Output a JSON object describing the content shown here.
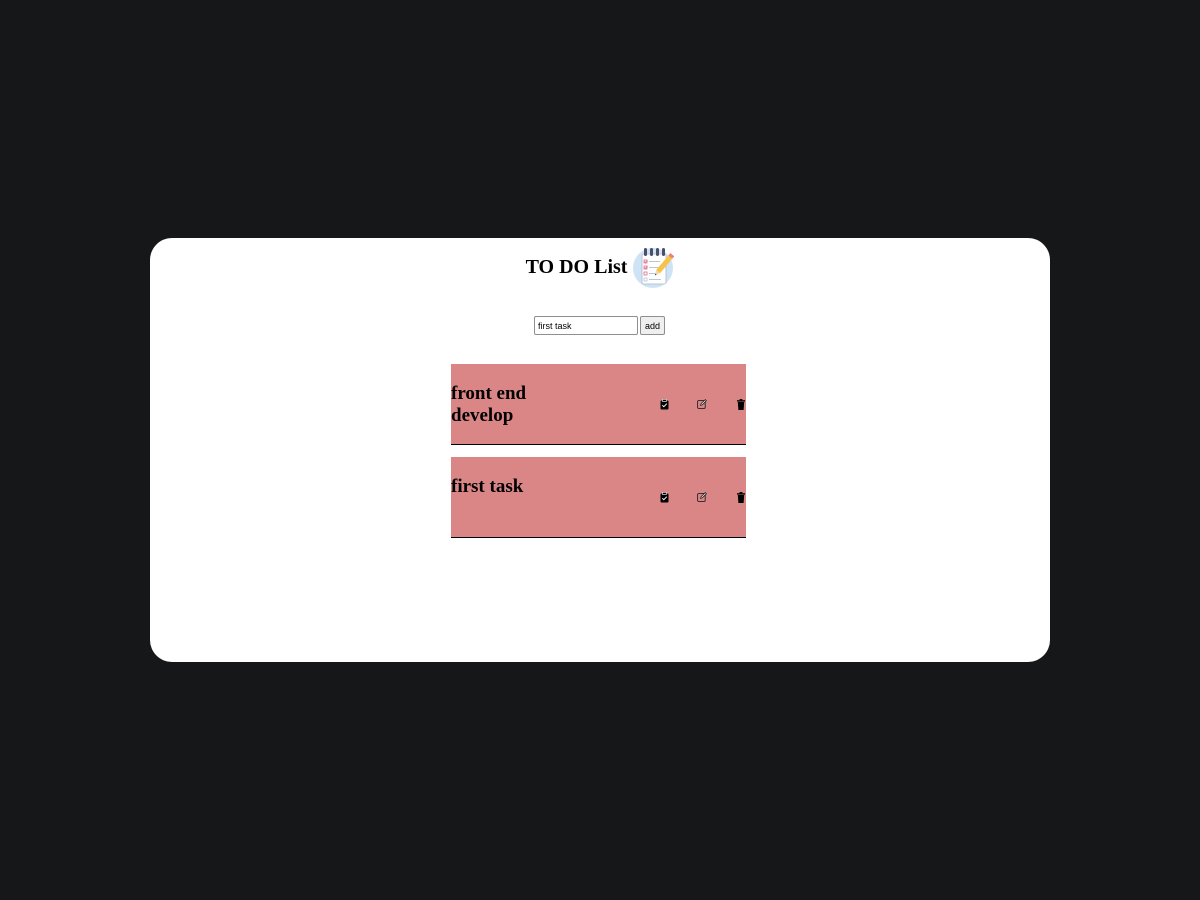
{
  "header": {
    "title": "TO DO List",
    "logo_icon": "notepad-checklist-icon"
  },
  "add_form": {
    "input_value": "first task",
    "button_label": "add"
  },
  "tasks": [
    {
      "text": "front end develop",
      "actions": [
        "clipboard-check-icon",
        "edit-icon",
        "trash-icon"
      ]
    },
    {
      "text": "first task",
      "actions": [
        "clipboard-check-icon",
        "edit-icon",
        "trash-icon"
      ]
    }
  ],
  "colors": {
    "backdrop": "#161719",
    "card": "#ffffff",
    "task_background": "#db8686"
  }
}
